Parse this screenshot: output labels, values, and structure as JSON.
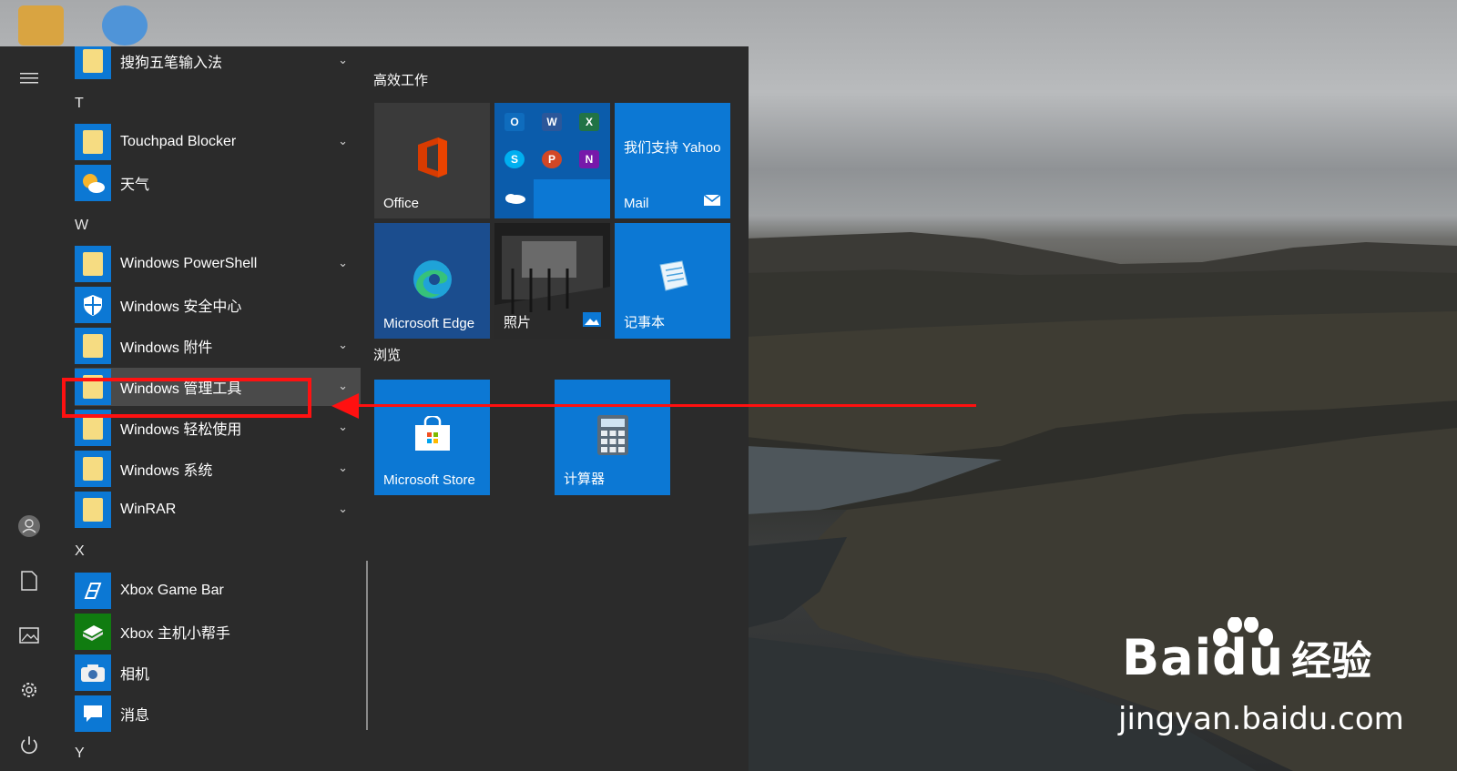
{
  "rail": {
    "items": [
      {
        "name": "hamburger-menu-icon",
        "glyph": "≡"
      },
      {
        "name": "user-avatar-icon",
        "glyph": "☺"
      },
      {
        "name": "documents-icon",
        "glyph": "🗋"
      },
      {
        "name": "pictures-icon",
        "glyph": "🖼"
      },
      {
        "name": "settings-gear-icon",
        "glyph": "⚙"
      },
      {
        "name": "power-icon",
        "glyph": "⏻"
      }
    ]
  },
  "applist": {
    "top_app": "搜狗五笔输入法",
    "letters": {
      "t": "T",
      "w": "W",
      "x": "X",
      "y": "Y"
    },
    "t_apps": [
      "Touchpad Blocker",
      "天气"
    ],
    "w_apps": [
      "Windows PowerShell",
      "Windows 安全中心",
      "Windows 附件",
      "Windows 管理工具",
      "Windows 轻松使用",
      "Windows 系统",
      "WinRAR"
    ],
    "x_apps": [
      "Xbox Game Bar",
      "Xbox 主机小帮手",
      "相机",
      "消息"
    ],
    "chevron": "⌄"
  },
  "tiles": {
    "group1": "高效工作",
    "group2": "浏览",
    "office": "Office",
    "mail_top": "我们支持 Yahoo",
    "mail": "Mail",
    "edge": "Microsoft Edge",
    "photos": "照片",
    "notepad": "记事本",
    "store": "Microsoft Store",
    "calculator": "计算器",
    "office_apps": [
      "O",
      "W",
      "X",
      "S",
      "P",
      "N"
    ]
  },
  "watermark": {
    "brand": "Bai",
    "brand2": "du",
    "cn": "经验",
    "url": "jingyan.baidu.com"
  },
  "colors": {
    "tile_blue": "#0c78d4",
    "highlight_red": "#ff1111",
    "folder_yellow": "#f6dc82"
  }
}
